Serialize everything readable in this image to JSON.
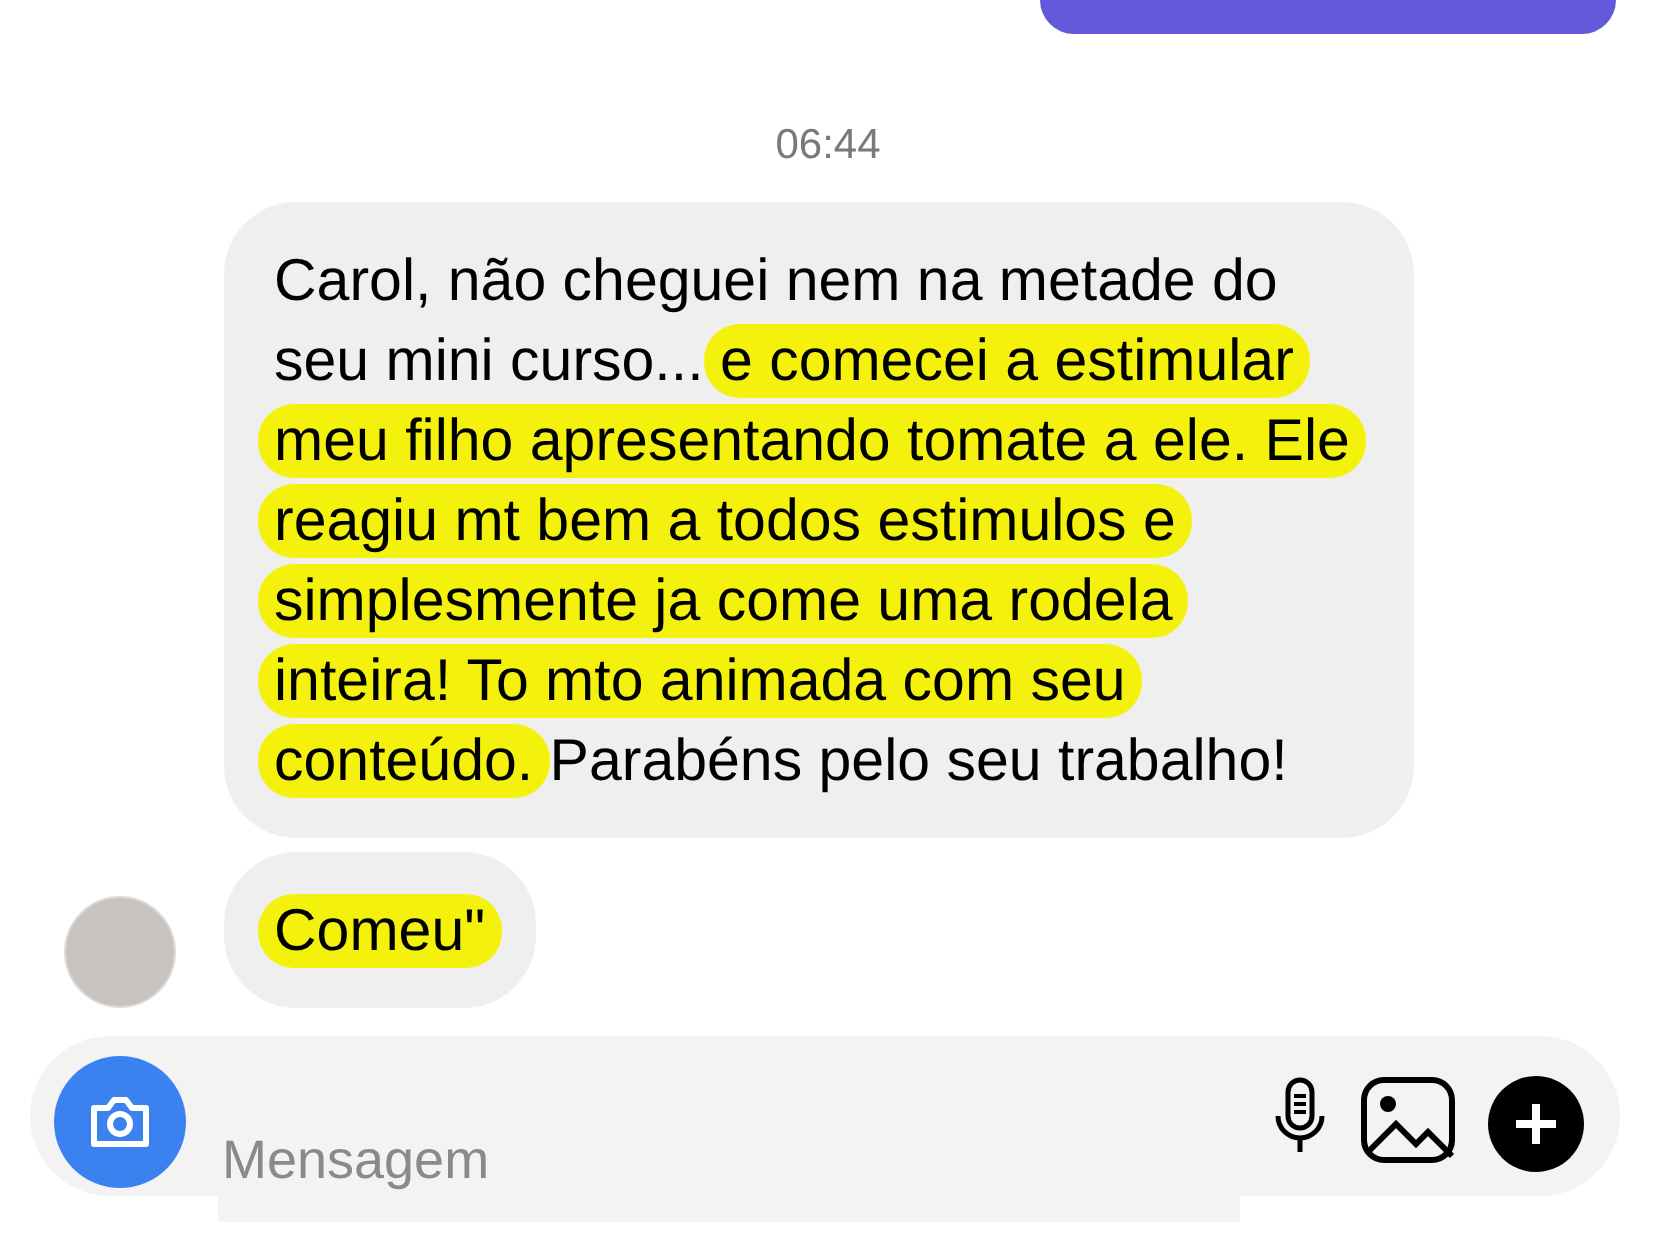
{
  "timestamp": "06:44",
  "messages": [
    {
      "segments": [
        {
          "text": "Carol, não cheguei nem na metade do seu mini curso... ",
          "highlighted": false
        },
        {
          "text": "e comecei a estimular meu filho apresentando tomate a ele. Ele reagiu mt bem a todos estimulos e simplesmente ja come uma rodela inteira! To mto animada com seu conteúdo.",
          "highlighted": true
        },
        {
          "text": " Parabéns pelo seu trabalho!",
          "highlighted": false
        }
      ]
    },
    {
      "segments": [
        {
          "text": "Comeu\"",
          "highlighted": true
        }
      ]
    }
  ],
  "composer": {
    "placeholder": "Mensagem"
  }
}
